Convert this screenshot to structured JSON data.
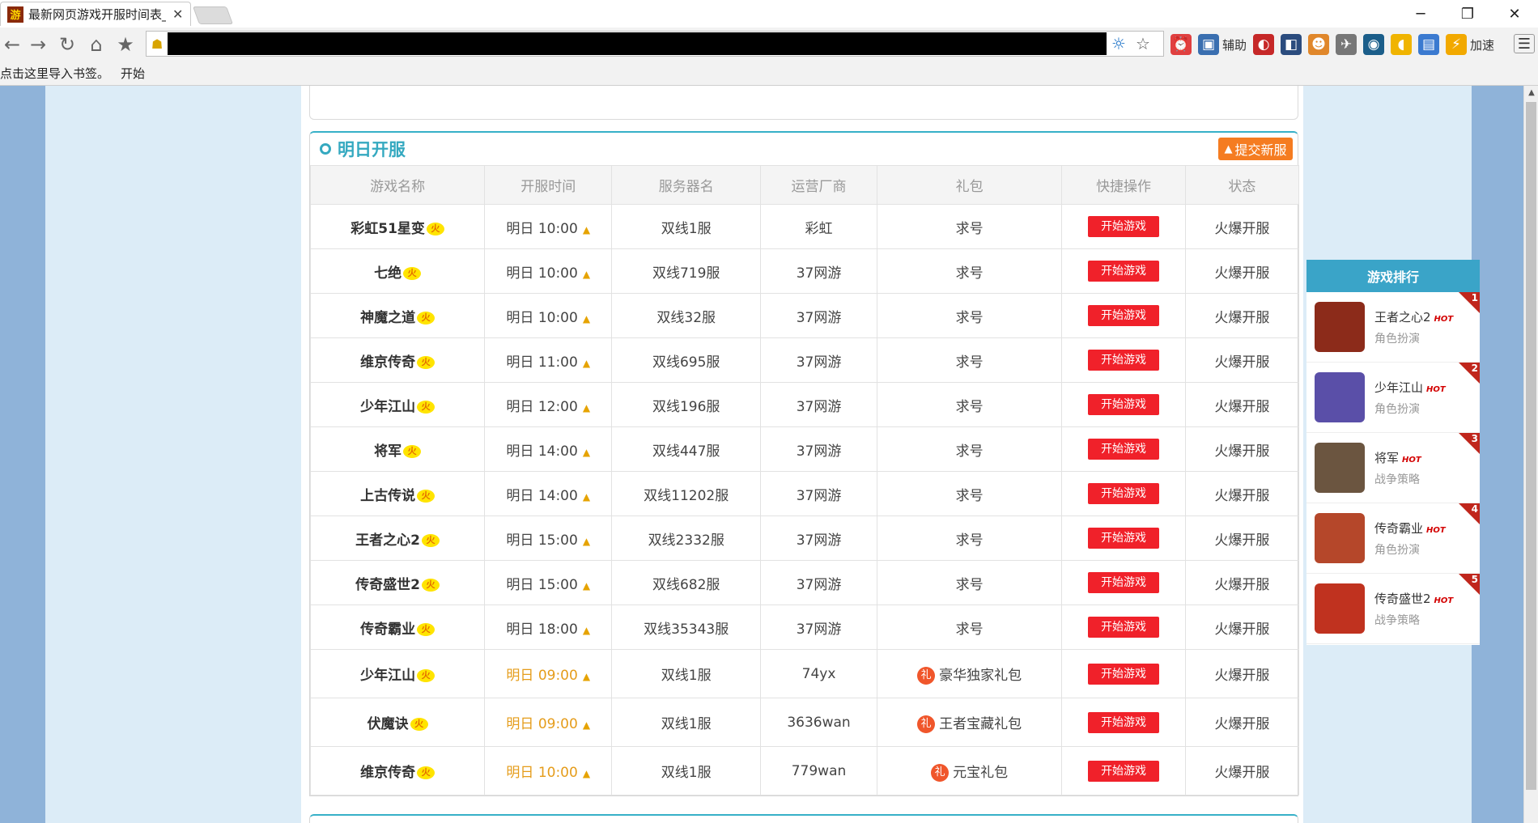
{
  "browser": {
    "tab_title": "最新网页游戏开服时间表_",
    "tab_favicon_text": "游",
    "close_glyph": "✕",
    "window_buttons": [
      "─",
      "❐",
      "✕"
    ],
    "bookmarks": [
      "点击这里导入书签。",
      "开始"
    ],
    "extensions": [
      {
        "label": "",
        "color": "#e04040",
        "glyph": "⏰"
      },
      {
        "label": "辅助",
        "color": "#3a6fb0",
        "glyph": "▣"
      },
      {
        "label": "",
        "color": "#c62828",
        "glyph": "◐"
      },
      {
        "label": "",
        "color": "#2b4c7e",
        "glyph": "◧"
      },
      {
        "label": "",
        "color": "#e0872b",
        "glyph": "☻"
      },
      {
        "label": "",
        "color": "#777777",
        "glyph": "✈"
      },
      {
        "label": "",
        "color": "#1b5e8a",
        "glyph": "◉"
      },
      {
        "label": "",
        "color": "#f0b400",
        "glyph": "◖"
      },
      {
        "label": "",
        "color": "#3b7ad0",
        "glyph": "▤"
      },
      {
        "label": "加速",
        "color": "#f2a900",
        "glyph": "⚡"
      }
    ]
  },
  "section": {
    "title": "明日开服",
    "submit_label": "提交新服",
    "columns": [
      "游戏名称",
      "开服时间",
      "服务器名",
      "运营厂商",
      "礼包",
      "快捷操作",
      "状态"
    ],
    "hot_badge": "火",
    "play_label": "开始游戏",
    "gift_glyph": "礼",
    "rows": [
      {
        "game": "彩虹51星变",
        "time": "明日 10:00",
        "server": "双线1服",
        "vendor": "彩虹",
        "gift": "求号",
        "status": "火爆开服"
      },
      {
        "game": "七绝",
        "time": "明日 10:00",
        "server": "双线719服",
        "vendor": "37网游",
        "gift": "求号",
        "status": "火爆开服"
      },
      {
        "game": "神魔之道",
        "time": "明日 10:00",
        "server": "双线32服",
        "vendor": "37网游",
        "gift": "求号",
        "status": "火爆开服"
      },
      {
        "game": "维京传奇",
        "time": "明日 11:00",
        "server": "双线695服",
        "vendor": "37网游",
        "gift": "求号",
        "status": "火爆开服"
      },
      {
        "game": "少年江山",
        "time": "明日 12:00",
        "server": "双线196服",
        "vendor": "37网游",
        "gift": "求号",
        "status": "火爆开服"
      },
      {
        "game": "将军",
        "time": "明日 14:00",
        "server": "双线447服",
        "vendor": "37网游",
        "gift": "求号",
        "status": "火爆开服"
      },
      {
        "game": "上古传说",
        "time": "明日 14:00",
        "server": "双线11202服",
        "vendor": "37网游",
        "gift": "求号",
        "status": "火爆开服"
      },
      {
        "game": "王者之心2",
        "time": "明日 15:00",
        "server": "双线2332服",
        "vendor": "37网游",
        "gift": "求号",
        "status": "火爆开服"
      },
      {
        "game": "传奇盛世2",
        "time": "明日 15:00",
        "server": "双线682服",
        "vendor": "37网游",
        "gift": "求号",
        "status": "火爆开服"
      },
      {
        "game": "传奇霸业",
        "time": "明日 18:00",
        "server": "双线35343服",
        "vendor": "37网游",
        "gift": "求号",
        "status": "火爆开服"
      },
      {
        "game": "少年江山",
        "time": "明日 09:00",
        "server": "双线1服",
        "vendor": "74yx",
        "gift": "豪华独家礼包",
        "status": "火爆开服"
      },
      {
        "game": "伏魔诀",
        "time": "明日 09:00",
        "server": "双线1服",
        "vendor": "3636wan",
        "gift": "王者宝藏礼包",
        "status": "火爆开服"
      },
      {
        "game": "维京传奇",
        "time": "明日 10:00",
        "server": "双线1服",
        "vendor": "779wan",
        "gift": "元宝礼包",
        "status": "火爆开服"
      }
    ]
  },
  "ranking": {
    "title": "游戏排行",
    "hot_label": "HOT",
    "items": [
      {
        "rank": "1",
        "name": "王者之心2",
        "category": "角色扮演",
        "thumb_color": "#8c2b1a"
      },
      {
        "rank": "2",
        "name": "少年江山",
        "category": "角色扮演",
        "thumb_color": "#5a4fa8"
      },
      {
        "rank": "3",
        "name": "将军",
        "category": "战争策略",
        "thumb_color": "#6b5540"
      },
      {
        "rank": "4",
        "name": "传奇霸业",
        "category": "角色扮演",
        "thumb_color": "#b5472a"
      },
      {
        "rank": "5",
        "name": "传奇盛世2",
        "category": "战争策略",
        "thumb_color": "#c0321f"
      }
    ]
  }
}
